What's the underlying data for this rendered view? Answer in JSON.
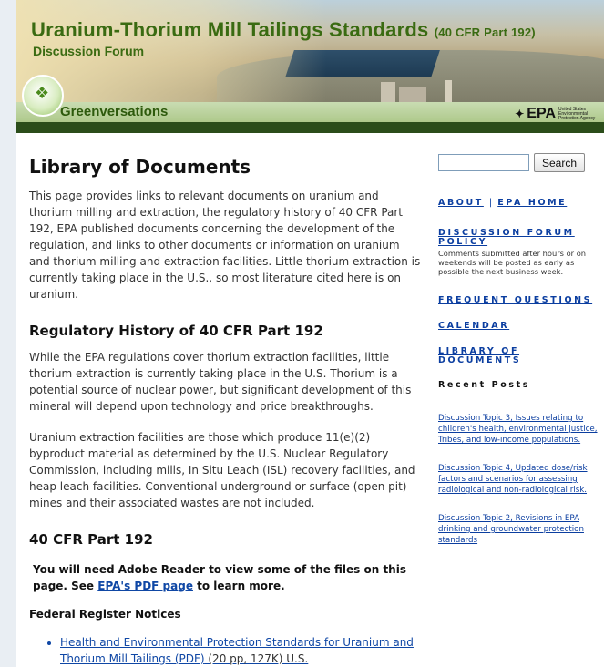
{
  "header": {
    "title": "Uranium-Thorium Mill Tailings Standards",
    "title_small": "(40 CFR Part 192)",
    "subtitle": "Discussion Forum",
    "brand": "Greenversations",
    "epa_logo": "EPA",
    "epa_small": "United States Environmental Protection Agency"
  },
  "main": {
    "page_title": "Library of Documents",
    "intro": "This page provides links to relevant documents on uranium and thorium milling and extraction, the regulatory history of 40 CFR Part 192, EPA published documents concerning the development of the regulation, and links to other documents or information on uranium and thorium milling and extraction facilities. Little thorium extraction is currently taking place in the U.S., so most literature cited here is on uranium.",
    "section1_title": "Regulatory History of 40 CFR Part 192",
    "section1_p1": "While the EPA regulations cover thorium extraction facilities, little thorium extraction is currently taking place in the U.S. Thorium is a potential source of nuclear power, but significant development of this mineral will depend upon technology and price breakthroughs.",
    "section1_p2": "Uranium extraction facilities are those which produce 11(e)(2) byproduct material as determined by the U.S. Nuclear Regulatory Commission, including mills, In Situ Leach (ISL) recovery facilities, and heap leach facilities. Conventional underground or surface (open pit) mines and their associated wastes are not included.",
    "section2_title": "40 CFR Part 192",
    "note_before": "You will need Adobe Reader to view some of the files on this page. See ",
    "note_link": "EPA's PDF page",
    "note_after": " to learn more.",
    "subhead": "Federal Register Notices",
    "list": [
      {
        "link": "Health and Environmental Protection Standards for Uranium and Thorium Mill Tailings (PDF)",
        "tail": " (20 pp, 127K) U.S."
      }
    ]
  },
  "sidebar": {
    "search_placeholder": "",
    "search_button": "Search",
    "about": "About",
    "divider": "|",
    "epa_home": "EPA Home",
    "policy": "Discussion Forum Policy",
    "policy_note": "Comments submitted after hours or on weekends will be posted as early as possible the next business week.",
    "faq": "Frequent Questions",
    "calendar": "Calendar",
    "library": "Library of Documents",
    "recent_head": "Recent Posts",
    "posts": [
      "Discussion Topic 3, Issues relating to children's health, environmental justice, Tribes, and low-income populations.",
      "Discussion Topic 4, Updated dose/risk factors and scenarios for assessing radiological and non-radiological risk.",
      "Discussion Topic 2, Revisions in EPA drinking and groundwater protection standards"
    ]
  }
}
